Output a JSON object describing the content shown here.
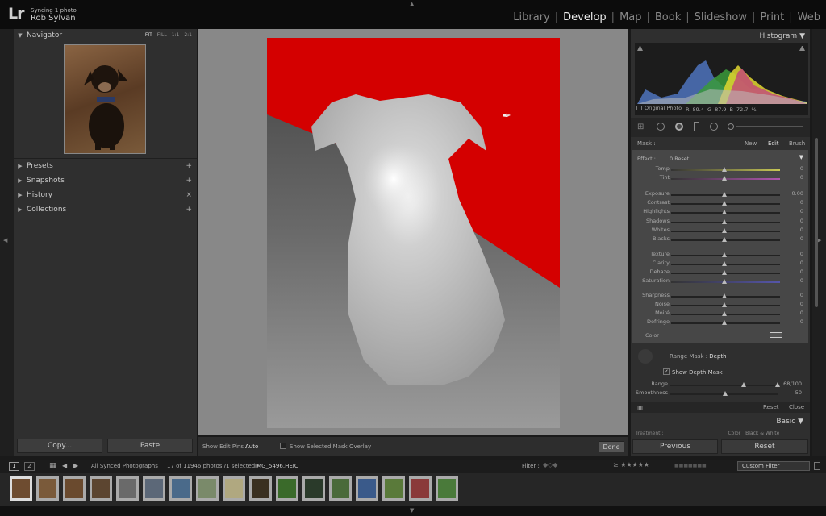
{
  "app": {
    "logo": "Lr",
    "sync_status": "Syncing 1 photo",
    "user": "Rob Sylvan"
  },
  "modules": [
    "Library",
    "Develop",
    "Map",
    "Book",
    "Slideshow",
    "Print",
    "Web"
  ],
  "active_module": "Develop",
  "left": {
    "navigator": {
      "title": "Navigator",
      "zoom": [
        "FIT",
        "FILL",
        "1:1",
        "2:1"
      ]
    },
    "panels": [
      "Presets",
      "Snapshots",
      "History",
      "Collections"
    ],
    "copy_label": "Copy...",
    "paste_label": "Paste"
  },
  "toolbar": {
    "edit_pins_label": "Show Edit Pins :",
    "edit_pins_value": "Auto",
    "overlay_label": "Show Selected Mask Overlay",
    "done_label": "Done"
  },
  "right": {
    "histogram": {
      "title": "Histogram",
      "r_label": "R",
      "r": "89.4",
      "g_label": "G",
      "g": "87.9",
      "b_label": "B",
      "b": "72.7",
      "unit": "%",
      "original_photo": "Original Photo"
    },
    "mask": {
      "label": "Mask :",
      "new": "New",
      "edit": "Edit",
      "brush": "Brush"
    },
    "effect": {
      "label": "Effect :",
      "value": "0 Reset"
    },
    "sliders": [
      {
        "label": "Temp",
        "value": "0"
      },
      {
        "label": "Tint",
        "value": "0"
      },
      {
        "label": "Exposure",
        "value": "0.00"
      },
      {
        "label": "Contrast",
        "value": "0"
      },
      {
        "label": "Highlights",
        "value": "0"
      },
      {
        "label": "Shadows",
        "value": "0"
      },
      {
        "label": "Whites",
        "value": "0"
      },
      {
        "label": "Blacks",
        "value": "0"
      },
      {
        "label": "Texture",
        "value": "0"
      },
      {
        "label": "Clarity",
        "value": "0"
      },
      {
        "label": "Dehaze",
        "value": "0"
      },
      {
        "label": "Saturation",
        "value": "0"
      },
      {
        "label": "Sharpness",
        "value": "0"
      },
      {
        "label": "Noise",
        "value": "0"
      },
      {
        "label": "Moiré",
        "value": "0"
      },
      {
        "label": "Defringe",
        "value": "0"
      }
    ],
    "color_label": "Color",
    "range_mask": {
      "label": "Range Mask :",
      "value": "Depth",
      "show_depth": "Show Depth Mask",
      "range_label": "Range",
      "range_value": "68/100",
      "smooth_label": "Smoothness",
      "smooth_value": "50",
      "reset": "Reset",
      "close": "Close"
    },
    "basic_title": "Basic",
    "treatment": {
      "label": "Treatment :",
      "color": "Color",
      "bw": "Black & White"
    },
    "previous_label": "Previous",
    "reset_label": "Reset"
  },
  "filmbar": {
    "page1": "1",
    "page2": "2",
    "source": "All Synced Photographs",
    "count": "17 of 11946 photos /1 selected /",
    "file": "IMG_5496.HEIC",
    "filter_label": "Filter :",
    "custom_filter": "Custom Filter"
  },
  "colors": {
    "accent_red": "#d40000",
    "bg_dark": "#1a1a1a",
    "panel": "#2f2f2f"
  }
}
